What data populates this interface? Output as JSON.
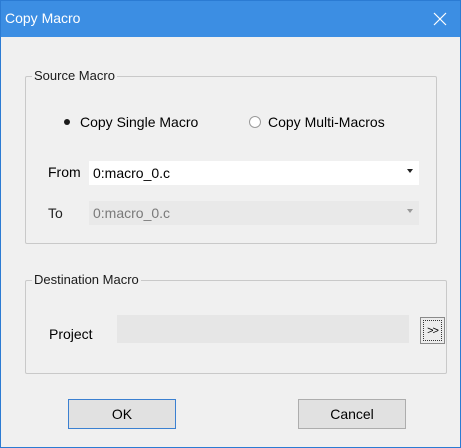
{
  "window": {
    "title": "Copy Macro"
  },
  "source_group": {
    "legend": "Source Macro",
    "radio_single": {
      "label": "Copy Single Macro",
      "checked": true
    },
    "radio_multi": {
      "label": "Copy Multi-Macros",
      "checked": false
    },
    "from": {
      "label": "From",
      "value": "0:macro_0.c"
    },
    "to": {
      "label": "To",
      "value": "0:macro_0.c",
      "disabled": true
    }
  },
  "destination_group": {
    "legend": "Destination Macro",
    "project": {
      "label": "Project",
      "value": ""
    },
    "browse_label": ">>"
  },
  "buttons": {
    "ok": "OK",
    "cancel": "Cancel"
  },
  "colors": {
    "titlebar": "#3c8ee3",
    "window_bg": "#f0f0f0",
    "border": "#2b7bd3"
  }
}
